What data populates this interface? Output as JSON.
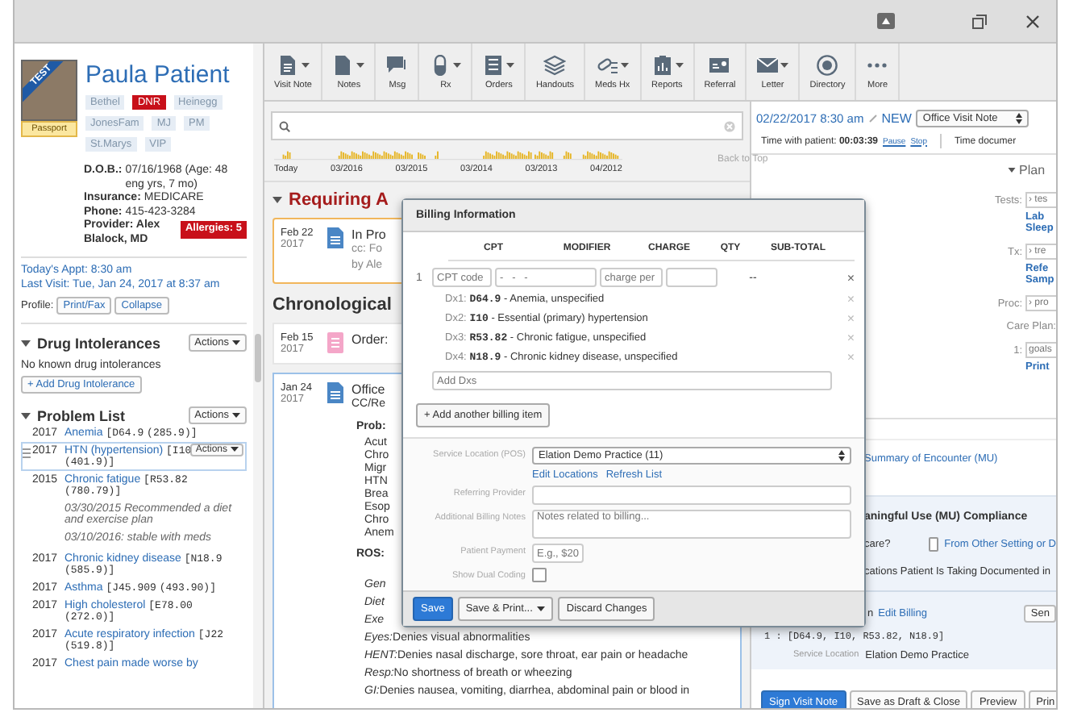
{
  "patient": {
    "ribbon": "TEST",
    "badge": "Passport",
    "name": "Paula Patient",
    "tags": [
      {
        "label": "Bethel",
        "kind": "plain"
      },
      {
        "label": "DNR",
        "kind": "alert"
      },
      {
        "label": "Heinegg",
        "kind": "plain"
      },
      {
        "label": "JonesFam",
        "kind": "plain"
      },
      {
        "label": "MJ",
        "kind": "plain"
      },
      {
        "label": "PM",
        "kind": "plain"
      },
      {
        "label": "St.Marys",
        "kind": "plain"
      },
      {
        "label": "VIP",
        "kind": "plain"
      }
    ],
    "details": [
      {
        "label": "D.O.B.:",
        "value": "07/16/1968 (Age: 48  eng yrs, 7 mo)"
      },
      {
        "label": "Insurance:",
        "value": "MEDICARE"
      },
      {
        "label": "Phone:",
        "value": "415-423-3284"
      }
    ],
    "provider": "Provider: Alex Blalock, MD",
    "allergies": "Allergies: 5",
    "appointment": "Today's Appt: 8:30 am",
    "last_visit": "Last Visit: Tue, Jan 24, 2017 at 8:37 am",
    "profile": {
      "label": "Profile:",
      "buttons": [
        "Print/Fax",
        "Collapse"
      ]
    }
  },
  "drug_intolerances": {
    "title": "Drug Intolerances",
    "expanded": true,
    "actions": "Actions",
    "empty": "No known drug intolerances",
    "add": "+ Add Drug Intolerance"
  },
  "problem_list": {
    "title": "Problem List",
    "expanded": true,
    "actions": "Actions",
    "row_actions": "Actions",
    "items": [
      {
        "year": "2017",
        "name": "Anemia",
        "code": "[D64.9",
        "icd9": "(285.9)]",
        "selected": false
      },
      {
        "year": "2017",
        "name": "HTN (hypertension)",
        "code": "[I10",
        "icd9": "(401.9)]",
        "selected": true
      },
      {
        "year": "2015",
        "name": "Chronic fatigue",
        "code": "[R53.82",
        "icd9": "(780.79)]",
        "selected": false,
        "notes": [
          "03/30/2015 Recommended a diet and exercise plan",
          "03/10/2016: stable with meds"
        ]
      },
      {
        "year": "2017",
        "name": "Chronic kidney disease",
        "code": "[N18.9",
        "icd9": "(585.9)]",
        "selected": false
      },
      {
        "year": "2017",
        "name": "Asthma",
        "code": "[J45.909",
        "icd9": "(493.90)]",
        "selected": false
      },
      {
        "year": "2017",
        "name": "High cholesterol",
        "code": "[E78.00",
        "icd9": "(272.0)]",
        "selected": false
      },
      {
        "year": "2017",
        "name": "Acute respiratory infection",
        "code": "[J22",
        "icd9": "(519.8)]",
        "selected": false
      },
      {
        "year": "2017",
        "name": "Chest pain made worse by",
        "selected": false
      }
    ]
  },
  "toolbar": [
    {
      "label": "Visit Note",
      "menu": true
    },
    {
      "label": "Notes",
      "menu": true
    },
    {
      "label": "Msg",
      "menu": false
    },
    {
      "label": "Rx",
      "menu": true
    },
    {
      "label": "Orders",
      "menu": true
    },
    {
      "label": "Handouts",
      "menu": false
    },
    {
      "label": "Meds Hx",
      "menu": true
    },
    {
      "label": "Reports",
      "menu": true
    },
    {
      "label": "Referral",
      "menu": false
    },
    {
      "label": "Letter",
      "menu": true
    },
    {
      "label": "Directory",
      "menu": false
    },
    {
      "label": "More",
      "menu": false
    }
  ],
  "timeline": {
    "labels": [
      "Today",
      "03/2016",
      "03/2015",
      "03/2014",
      "03/2013",
      "04/2012"
    ],
    "back_to_top": "Back to Top"
  },
  "requiring": {
    "title": "Requiring A",
    "expanded": true,
    "cards": [
      {
        "month_day": "Feb 22",
        "year": "2017",
        "kind": "note",
        "in_progress": true,
        "selected": false,
        "title": "In Pro",
        "lines": [
          "cc: Fo",
          "by Ale"
        ]
      }
    ]
  },
  "chronological": {
    "title": "Chronological",
    "cards": [
      {
        "month_day": "Feb 15",
        "year": "2017",
        "kind": "order",
        "in_progress": false,
        "selected": false,
        "title": "Order:"
      },
      {
        "month_day": "Jan 24",
        "year": "2017",
        "kind": "note",
        "in_progress": false,
        "selected": true,
        "title": "Office",
        "lines": [
          "CC/Re"
        ],
        "problems_label": "Prob:",
        "problems": [
          "Acut",
          "Chro",
          "Migr",
          "HTN",
          "Brea",
          "Esop",
          "Chro",
          "Anem"
        ],
        "ros_label": "ROS:",
        "ros": [
          {
            "label": "Gen"
          },
          {
            "label": "Diet"
          },
          {
            "label": "Exe"
          },
          {
            "label": "Eyes:",
            "text": "Denies visual abnormalities"
          },
          {
            "label": "HENT:",
            "text": "Denies nasal discharge, sore throat, ear pain or headache"
          },
          {
            "label": "Resp:",
            "text": "No shortness of breath or wheezing"
          },
          {
            "label": "GI:",
            "text": "Denies nausea, vomiting, diarrhea, abdominal pain or blood in"
          }
        ]
      }
    ]
  },
  "visit": {
    "date": "02/22/2017 8:30 am",
    "status": "NEW",
    "note_type": "Office Visit Note",
    "timer_label": "Time with patient:",
    "timer": "00:03:39",
    "pause": "Pause",
    "stop": "Stop",
    "documented": "Time documer"
  },
  "plan": {
    "title": "Plan",
    "expanded": true,
    "rows": [
      {
        "label": "Tests:",
        "placeholder": "› tes",
        "links": [
          "Lab",
          "Sleep"
        ]
      },
      {
        "label": "Tx:",
        "placeholder": "› tre",
        "links": [
          "Refe",
          "Samp"
        ]
      },
      {
        "label": "Proc:",
        "placeholder": "› pro"
      },
      {
        "label": "Care Plan:"
      },
      {
        "label": "1:",
        "placeholder": "goals",
        "links": [
          "Print"
        ]
      }
    ]
  },
  "summary_link": "Summary of Encounter (MU)",
  "mu": {
    "title": "aningful Use (MU) Compliance",
    "question": "care?",
    "option": {
      "label": "From Other Setting or D",
      "checked": false
    },
    "note": "cations Patient Is Taking Documented in"
  },
  "billing_summary": {
    "title": "n",
    "edit": "Edit Billing",
    "send": "Sen",
    "codes": "1 : [D64.9, I10, R53.82, N18.9]",
    "location_label": "Service Location",
    "location": "Elation Demo Practice"
  },
  "actions": [
    {
      "label": "Sign Visit Note",
      "primary": true
    },
    {
      "label": "Save as Draft & Close",
      "primary": false
    },
    {
      "label": "Preview",
      "primary": false
    },
    {
      "label": "Prin",
      "primary": false
    }
  ],
  "billing_dialog": {
    "title": "Billing Information",
    "columns": [
      "CPT",
      "MODIFIER",
      "CHARGE",
      "QTY",
      "SUB-TOTAL"
    ],
    "item": {
      "index": "1",
      "cpt_placeholder": "CPT code",
      "modifier_placeholder": "-   -   -",
      "charge_placeholder": "charge per",
      "subtotal": "--",
      "remove": "×"
    },
    "dx": [
      {
        "label": "Dx1:",
        "code": "D64.9",
        "description": "- Anemia, unspecified",
        "remove": "×"
      },
      {
        "label": "Dx2:",
        "code": "I10",
        "description": "- Essential (primary) hypertension",
        "remove": "×"
      },
      {
        "label": "Dx3:",
        "code": "R53.82",
        "description": "- Chronic fatigue, unspecified",
        "remove": "×"
      },
      {
        "label": "Dx4:",
        "code": "N18.9",
        "description": "- Chronic kidney disease, unspecified",
        "remove": "×"
      }
    ],
    "add_dx_placeholder": "Add Dxs",
    "add_item": "+ Add another billing item",
    "location_label": "Service Location (POS)",
    "location": "Elation Demo Practice (11)",
    "location_links": [
      "Edit Locations",
      "Refresh List"
    ],
    "referring_label": "Referring Provider",
    "notes_label": "Additional Billing Notes",
    "notes_placeholder": "Notes related to billing...",
    "payment_label": "Patient Payment",
    "payment_placeholder": "E.g., $20",
    "dual_label": "Show Dual Coding",
    "dual_checked": false,
    "buttons": [
      {
        "label": "Save",
        "kind": "primary"
      },
      {
        "label": "Save & Print...",
        "kind": "menu"
      },
      {
        "label": "Discard Changes",
        "kind": "plain"
      }
    ]
  }
}
